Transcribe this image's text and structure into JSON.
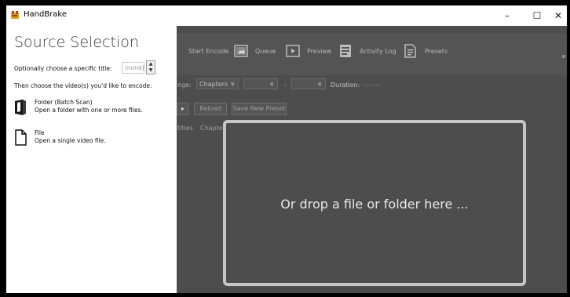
{
  "window": {
    "title": "HandBrake"
  },
  "window_controls": {
    "minimize": "–",
    "maximize": "☐",
    "close": "✕"
  },
  "toolbar": {
    "start_encode": "Start Encode",
    "queue": "Queue",
    "preview": "Preview",
    "activity_log": "Activity Log",
    "presets": "Presets"
  },
  "range": {
    "range_label": "nge:",
    "range_value": "Chapters",
    "dash": "-",
    "duration_label": "Duration:",
    "duration_value": "--:--:--"
  },
  "presets_row": {
    "reload": "Reload",
    "save_new_preset": "Save New Preset"
  },
  "tabs": {
    "subtitles": "titles",
    "chapters": "Chapter"
  },
  "dropzone": {
    "text": "Or drop a file or folder here ..."
  },
  "source_panel": {
    "title": "Source Selection",
    "optional_title_label": "Optionally choose a specific title:",
    "title_value": "(none)",
    "choose_label": "Then choose the video(s) you'd like to encode:",
    "options": [
      {
        "name": "Folder (Batch Scan)",
        "description": "Open a folder with one or more files.",
        "icon": "folder-icon"
      },
      {
        "name": "File",
        "description": "Open a single video file.",
        "icon": "file-icon"
      }
    ]
  }
}
